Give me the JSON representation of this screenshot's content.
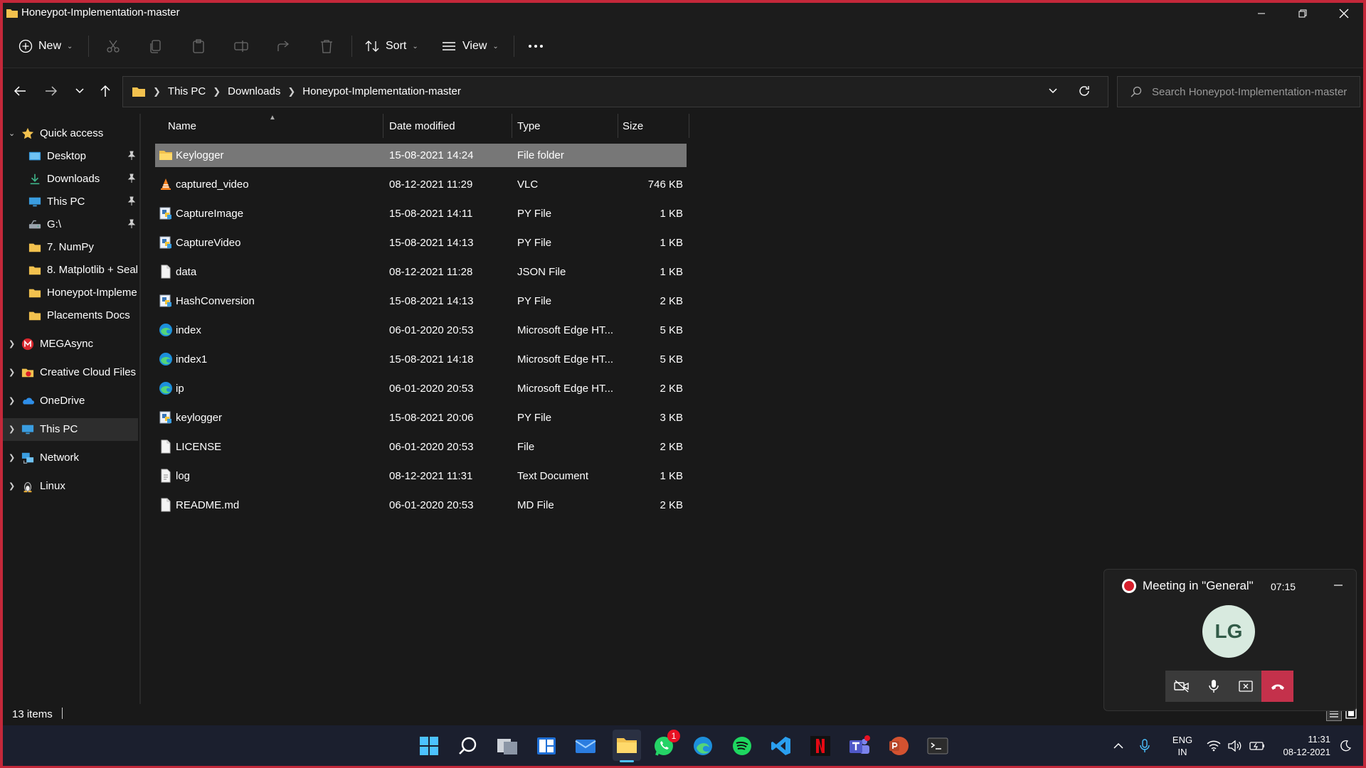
{
  "window": {
    "title": "Honeypot-Implementation-master"
  },
  "toolbar": {
    "new_label": "New",
    "sort_label": "Sort",
    "view_label": "View"
  },
  "address": {
    "crumbs": [
      "This PC",
      "Downloads",
      "Honeypot-Implementation-master"
    ]
  },
  "search": {
    "placeholder": "Search Honeypot-Implementation-master"
  },
  "sidebar": {
    "quick_access": "Quick access",
    "pinned": [
      {
        "label": "Desktop",
        "icon": "desktop-icon"
      },
      {
        "label": "Downloads",
        "icon": "downloads-icon"
      },
      {
        "label": "This PC",
        "icon": "pc-icon"
      },
      {
        "label": "G:\\",
        "icon": "drive-icon"
      },
      {
        "label": "7. NumPy",
        "icon": "folder-icon"
      },
      {
        "label": "8. Matplotlib + Seal",
        "icon": "folder-icon"
      },
      {
        "label": "Honeypot-Impleme",
        "icon": "folder-icon"
      },
      {
        "label": "Placements Docs",
        "icon": "folder-icon"
      }
    ],
    "roots": [
      {
        "label": "MEGAsync",
        "icon": "mega-icon"
      },
      {
        "label": "Creative Cloud Files",
        "icon": "creative-cloud-icon"
      },
      {
        "label": "OneDrive",
        "icon": "onedrive-icon"
      },
      {
        "label": "This PC",
        "icon": "pc-icon"
      },
      {
        "label": "Network",
        "icon": "network-icon"
      },
      {
        "label": "Linux",
        "icon": "linux-icon"
      }
    ]
  },
  "columns": {
    "name": "Name",
    "date": "Date modified",
    "type": "Type",
    "size": "Size"
  },
  "files": [
    {
      "name": "Keylogger",
      "date": "15-08-2021 14:24",
      "type": "File folder",
      "size": "",
      "icon": "folder-icon"
    },
    {
      "name": "captured_video",
      "date": "08-12-2021 11:29",
      "type": "VLC",
      "size": "746 KB",
      "icon": "vlc-icon"
    },
    {
      "name": "CaptureImage",
      "date": "15-08-2021 14:11",
      "type": "PY File",
      "size": "1 KB",
      "icon": "py-file-icon"
    },
    {
      "name": "CaptureVideo",
      "date": "15-08-2021 14:13",
      "type": "PY File",
      "size": "1 KB",
      "icon": "py-file-icon"
    },
    {
      "name": "data",
      "date": "08-12-2021 11:28",
      "type": "JSON File",
      "size": "1 KB",
      "icon": "file-icon"
    },
    {
      "name": "HashConversion",
      "date": "15-08-2021 14:13",
      "type": "PY File",
      "size": "2 KB",
      "icon": "py-file-icon"
    },
    {
      "name": "index",
      "date": "06-01-2020 20:53",
      "type": "Microsoft Edge HT...",
      "size": "5 KB",
      "icon": "edge-icon"
    },
    {
      "name": "index1",
      "date": "15-08-2021 14:18",
      "type": "Microsoft Edge HT...",
      "size": "5 KB",
      "icon": "edge-icon"
    },
    {
      "name": "ip",
      "date": "06-01-2020 20:53",
      "type": "Microsoft Edge HT...",
      "size": "2 KB",
      "icon": "edge-icon"
    },
    {
      "name": "keylogger",
      "date": "15-08-2021 20:06",
      "type": "PY File",
      "size": "3 KB",
      "icon": "py-file-icon"
    },
    {
      "name": "LICENSE",
      "date": "06-01-2020 20:53",
      "type": "File",
      "size": "2 KB",
      "icon": "file-icon"
    },
    {
      "name": "log",
      "date": "08-12-2021 11:31",
      "type": "Text Document",
      "size": "1 KB",
      "icon": "text-file-icon"
    },
    {
      "name": "README.md",
      "date": "06-01-2020 20:53",
      "type": "MD File",
      "size": "2 KB",
      "icon": "file-icon"
    }
  ],
  "status": {
    "count": "13 items"
  },
  "meeting": {
    "title": "Meeting in \"General\"",
    "time": "07:15",
    "initials": "LG"
  },
  "taskbar": {
    "whatsapp_badge": "1",
    "lang": "ENG",
    "region": "IN",
    "time": "11:31",
    "date": "08-12-2021"
  },
  "colors": {
    "accent": "#c4283a",
    "folder": "#f2c14e",
    "selection": "#777777",
    "hangup": "#c4314b"
  }
}
